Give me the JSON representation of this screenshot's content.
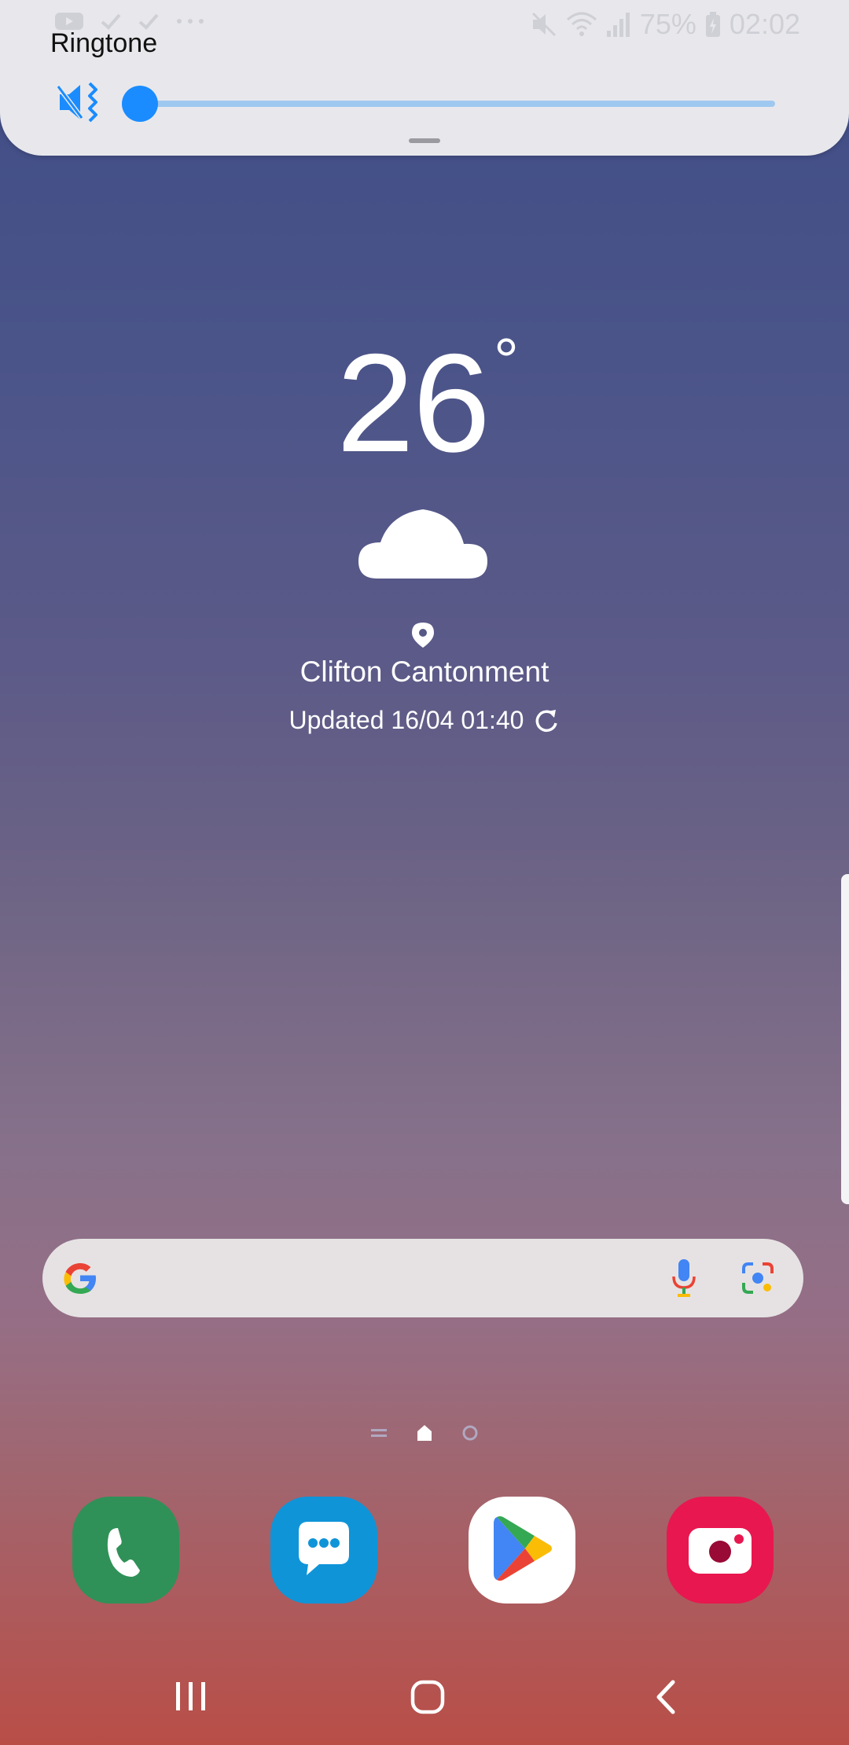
{
  "status_bar": {
    "left_icons": [
      "youtube-notification-icon",
      "check-icon",
      "check-icon",
      "more-dots-icon"
    ],
    "battery": "75%",
    "time": "02:02"
  },
  "volume_panel": {
    "title": "Ringtone",
    "level_fraction": 0.0,
    "mode_icon": "vibrate-mute-icon",
    "accent_color": "#1a8cff"
  },
  "weather": {
    "temperature": "26",
    "degree_symbol": "°",
    "condition_icon": "cloud-icon",
    "location": "Clifton Cantonment",
    "updated": "Updated 16/04 01:40"
  },
  "search": {
    "logo_icon": "google-logo-icon",
    "mic_icon": "mic-icon",
    "lens_icon": "lens-icon"
  },
  "page_indicator": {
    "items": [
      "list-page-icon",
      "home-page-icon",
      "page-dot-icon"
    ],
    "active": 1
  },
  "dock": [
    {
      "name": "Phone",
      "icon": "phone-icon",
      "color": "#2f9157"
    },
    {
      "name": "Messages",
      "icon": "messages-icon",
      "color": "#0f94d8"
    },
    {
      "name": "Play Store",
      "icon": "play-store-icon",
      "color": "#ffffff"
    },
    {
      "name": "Camera",
      "icon": "camera-icon",
      "color": "#e8174f"
    }
  ],
  "nav_bar": {
    "buttons": [
      "recents-icon",
      "home-icon",
      "back-icon"
    ]
  }
}
